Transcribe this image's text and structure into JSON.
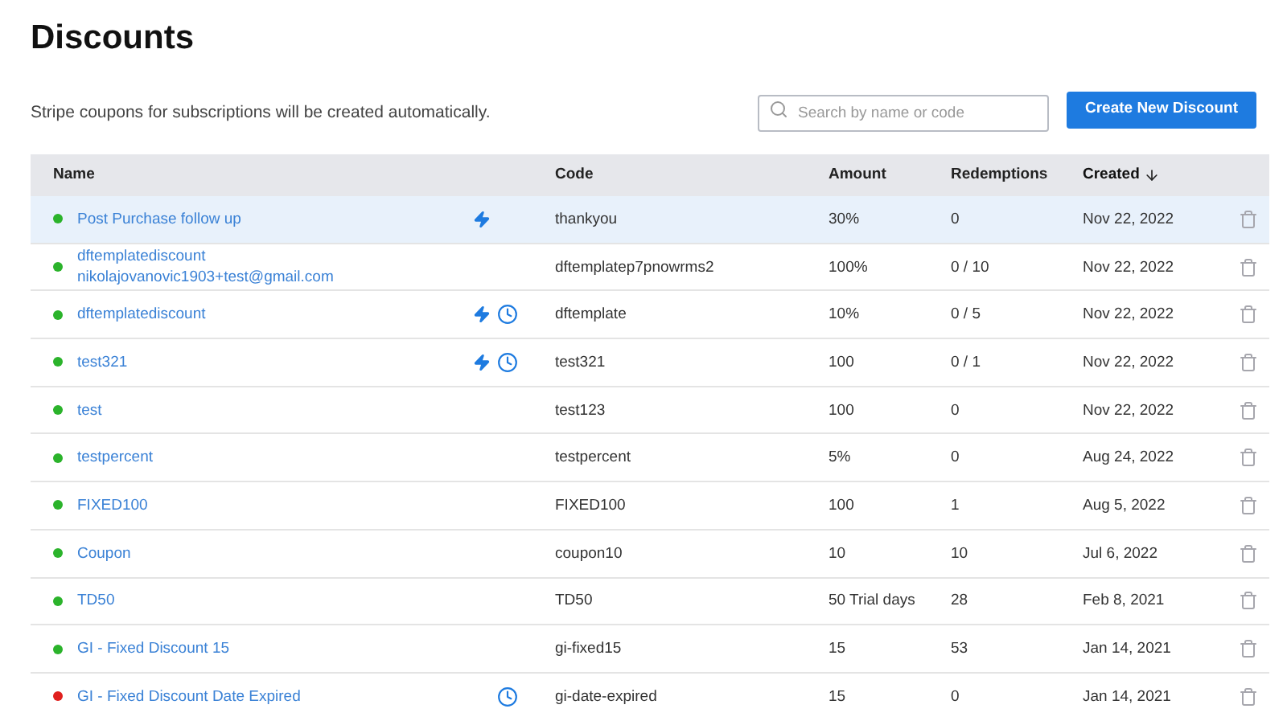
{
  "page": {
    "title": "Discounts",
    "description": "Stripe coupons for subscriptions will be created automatically."
  },
  "search": {
    "placeholder": "Search by name or code"
  },
  "create_button": "Create New Discount",
  "table": {
    "columns": [
      {
        "label": "Name",
        "sorted": false
      },
      {
        "label": "Code",
        "sorted": false
      },
      {
        "label": "Amount",
        "sorted": false
      },
      {
        "label": "Redemptions",
        "sorted": false
      },
      {
        "label": "Created",
        "sorted": true
      }
    ],
    "rows": [
      {
        "name": "Post Purchase follow up",
        "color": "#2bb32b",
        "instant": true,
        "scheduled": false,
        "code": "thankyou",
        "amount": "30%",
        "redemptions": "0",
        "created": "Nov 22, 2022",
        "selected": true
      },
      {
        "name": "dftemplatediscount",
        "email": "nikolajovanovic1903+test@gmail.com",
        "color": "#2bb32b",
        "instant": false,
        "scheduled": false,
        "code": "dftemplatep7pnowrms2",
        "amount": "100%",
        "redemptions": "0 / 10",
        "created": "Nov 22, 2022",
        "selected": false
      },
      {
        "name": "dftemplatediscount",
        "color": "#2bb32b",
        "instant": true,
        "scheduled": true,
        "code": "dftemplate",
        "amount": "10%",
        "redemptions": "0 / 5",
        "created": "Nov 22, 2022",
        "selected": false
      },
      {
        "name": "test321",
        "color": "#2bb32b",
        "instant": true,
        "scheduled": true,
        "code": "test321",
        "amount": "100",
        "redemptions": "0 / 1",
        "created": "Nov 22, 2022",
        "selected": false
      },
      {
        "name": "test",
        "color": "#2bb32b",
        "instant": false,
        "scheduled": false,
        "code": "test123",
        "amount": "100",
        "redemptions": "0",
        "created": "Nov 22, 2022",
        "selected": false
      },
      {
        "name": "testpercent",
        "color": "#2bb32b",
        "instant": false,
        "scheduled": false,
        "code": "testpercent",
        "amount": "5%",
        "redemptions": "0",
        "created": "Aug 24, 2022",
        "selected": false
      },
      {
        "name": "FIXED100",
        "color": "#2bb32b",
        "instant": false,
        "scheduled": false,
        "code": "FIXED100",
        "amount": "100",
        "redemptions": "1",
        "created": "Aug 5, 2022",
        "selected": false
      },
      {
        "name": "Coupon",
        "color": "#2bb32b",
        "instant": false,
        "scheduled": false,
        "code": "coupon10",
        "amount": "10",
        "redemptions": "10",
        "created": "Jul 6, 2022",
        "selected": false
      },
      {
        "name": "TD50",
        "color": "#2bb32b",
        "instant": false,
        "scheduled": false,
        "code": "TD50",
        "amount": "50 Trial days",
        "redemptions": "28",
        "created": "Feb 8, 2021",
        "selected": false
      },
      {
        "name": "GI - Fixed Discount 15",
        "color": "#2bb32b",
        "instant": false,
        "scheduled": false,
        "code": "gi-fixed15",
        "amount": "15",
        "redemptions": "53",
        "created": "Jan 14, 2021",
        "selected": false
      },
      {
        "name": "GI - Fixed Discount Date Expired",
        "color": "#e0201e",
        "instant": false,
        "scheduled": true,
        "code": "gi-date-expired",
        "amount": "15",
        "redemptions": "0",
        "created": "Jan 14, 2021",
        "selected": false
      }
    ]
  }
}
